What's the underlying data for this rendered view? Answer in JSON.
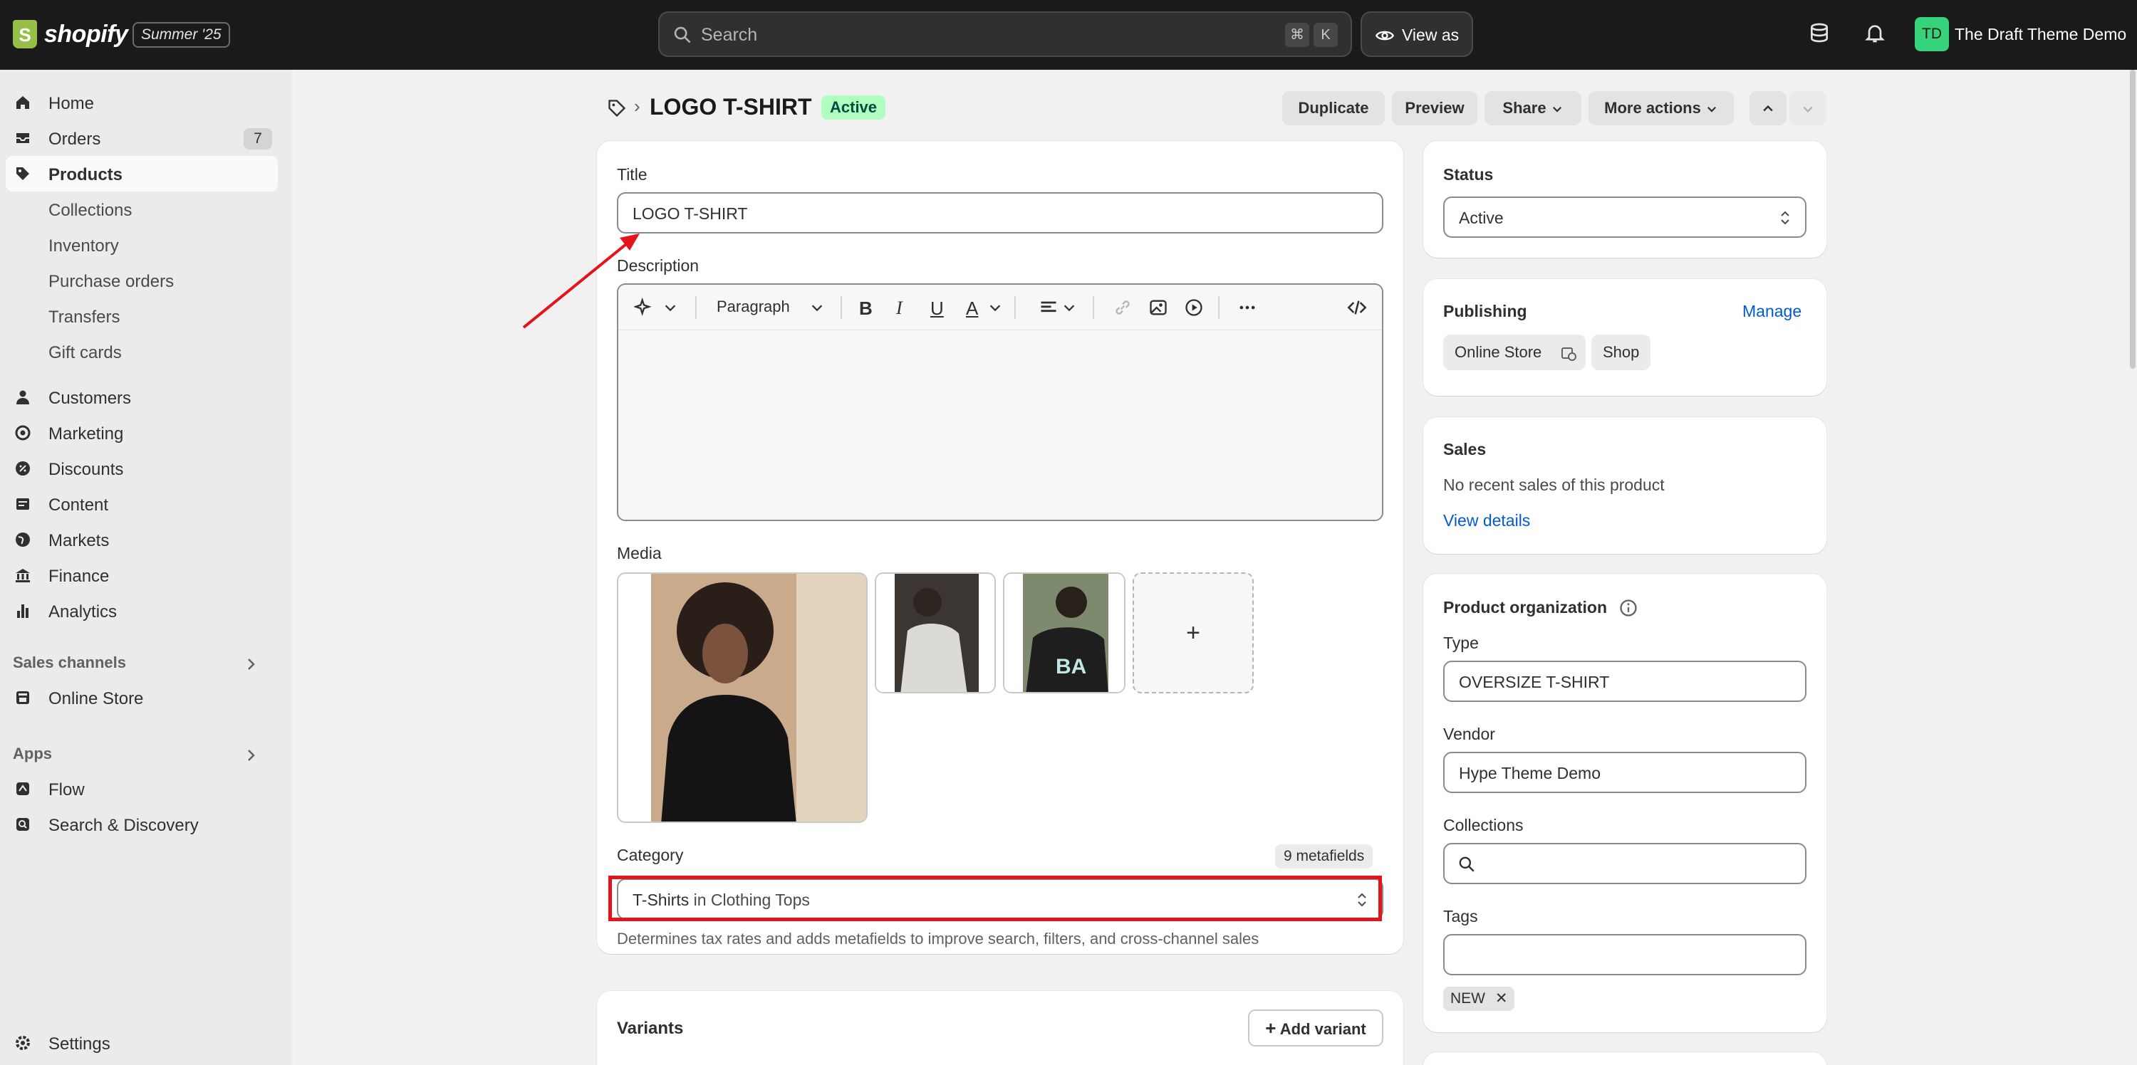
{
  "brand": {
    "logo_letter": "S",
    "name": "shopify",
    "edition": "Summer '25"
  },
  "search": {
    "placeholder": "Search",
    "shortcut_cmd": "⌘",
    "shortcut_key": "K"
  },
  "view_as": {
    "label": "View as"
  },
  "store": {
    "initials": "TD",
    "name": "The Draft Theme Demo"
  },
  "sidebar": {
    "items": [
      {
        "label": "Home",
        "icon": "home-icon"
      },
      {
        "label": "Orders",
        "icon": "orders-icon",
        "badge": "7"
      },
      {
        "label": "Products",
        "icon": "tag-icon",
        "active": true
      },
      {
        "label": "Collections",
        "sub": true
      },
      {
        "label": "Inventory",
        "sub": true
      },
      {
        "label": "Purchase orders",
        "sub": true
      },
      {
        "label": "Transfers",
        "sub": true
      },
      {
        "label": "Gift cards",
        "sub": true
      },
      {
        "label": "Customers",
        "icon": "person-icon"
      },
      {
        "label": "Marketing",
        "icon": "target-icon"
      },
      {
        "label": "Discounts",
        "icon": "discount-icon"
      },
      {
        "label": "Content",
        "icon": "content-icon"
      },
      {
        "label": "Markets",
        "icon": "globe-icon"
      },
      {
        "label": "Finance",
        "icon": "bank-icon"
      },
      {
        "label": "Analytics",
        "icon": "chart-icon"
      }
    ],
    "sales_channels_title": "Sales channels",
    "online_store": "Online Store",
    "apps_title": "Apps",
    "apps": [
      "Flow",
      "Search & Discovery"
    ],
    "settings": "Settings"
  },
  "header": {
    "title": "LOGO T-SHIRT",
    "status": "Active",
    "duplicate": "Duplicate",
    "preview": "Preview",
    "share": "Share",
    "more_actions": "More actions"
  },
  "product": {
    "title_label": "Title",
    "title_value": "LOGO T-SHIRT",
    "description_label": "Description",
    "paragraph": "Paragraph",
    "media_label": "Media",
    "media_add": "+",
    "category_label": "Category",
    "metafields": "9 metafields",
    "category_bold": "T-Shirts",
    "category_rest": " in Clothing Tops",
    "category_help": "Determines tax rates and adds metafields to improve search, filters, and cross-channel sales",
    "variants_label": "Variants",
    "add_variant": "Add variant"
  },
  "status_card": {
    "title": "Status",
    "value": "Active"
  },
  "publishing": {
    "title": "Publishing",
    "manage": "Manage",
    "channels": [
      "Online Store",
      "Shop"
    ]
  },
  "sales": {
    "title": "Sales",
    "text": "No recent sales of this product",
    "link": "View details"
  },
  "organization": {
    "title": "Product organization",
    "type_label": "Type",
    "type_value": "OVERSIZE T-SHIRT",
    "vendor_label": "Vendor",
    "vendor_value": "Hype Theme Demo",
    "collections_label": "Collections",
    "tags_label": "Tags",
    "tag": "NEW"
  },
  "colors": {
    "accent_link": "#005bd3",
    "active_badge": "#affebf",
    "annotation": "#e3141b"
  }
}
